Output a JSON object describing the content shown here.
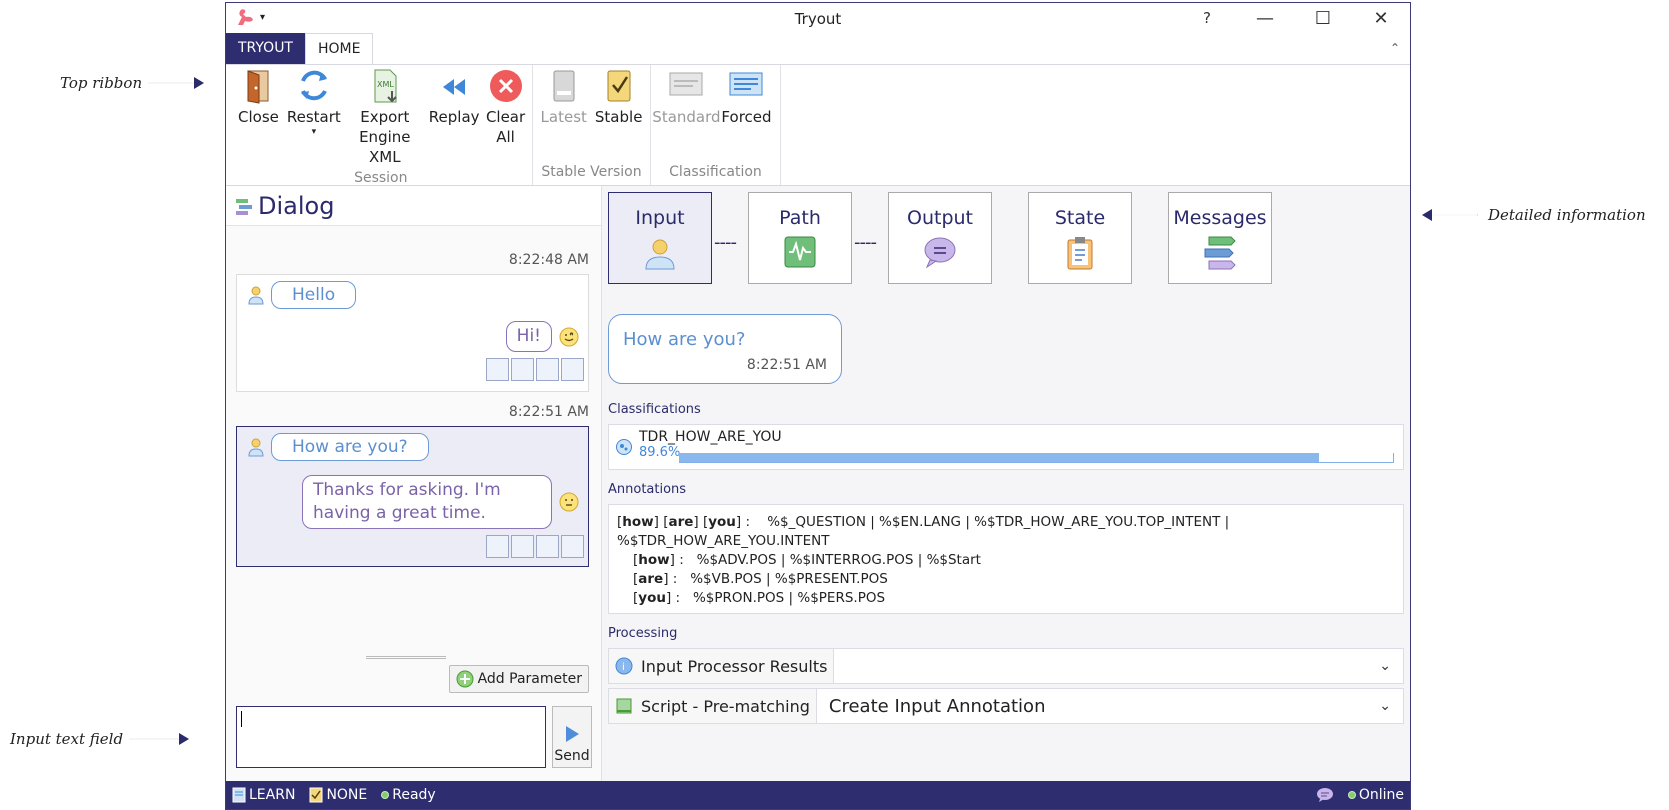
{
  "callouts": {
    "top_ribbon": "Top ribbon",
    "detailed_information": "Detailed information",
    "input_text_field": "Input text field"
  },
  "window": {
    "title": "Tryout",
    "help": "?",
    "minimize": "—",
    "maximize": "☐",
    "close": "✕"
  },
  "tabs": {
    "tryout": "TRYOUT",
    "home": "HOME"
  },
  "ribbon": {
    "session": {
      "label": "Session",
      "close": "Close",
      "restart": "Restart",
      "export": "Export Engine XML",
      "replay": "Replay",
      "clear": "Clear All"
    },
    "stable_version": {
      "label": "Stable Version",
      "latest": "Latest",
      "stable": "Stable"
    },
    "classification": {
      "label": "Classification",
      "standard": "Standard",
      "forced": "Forced"
    }
  },
  "dialog": {
    "title": "Dialog",
    "conversations": [
      {
        "time": "8:22:48 AM",
        "user": "Hello",
        "bot": "Hi!"
      },
      {
        "time": "8:22:51 AM",
        "user": "How are you?",
        "bot": "Thanks for asking. I'm having a great time."
      }
    ],
    "add_parameter": "Add Parameter",
    "send": "Send"
  },
  "details": {
    "cards": [
      "Input",
      "Path",
      "Output",
      "State",
      "Messages"
    ],
    "connector": "----",
    "selected_message": {
      "text": "How are you?",
      "time": "8:22:51 AM"
    },
    "classifications_label": "Classifications",
    "classification": {
      "name": "TDR_HOW_ARE_YOU",
      "percent": "89.6%",
      "fraction": 0.896
    },
    "annotations_label": "Annotations",
    "annotations": {
      "line1_words": [
        "how",
        "are",
        "you"
      ],
      "line1_sep": "] [",
      "line1_tags": "%$_QUESTION  |  %$EN.LANG  |  %$TDR_HOW_ARE_YOU.TOP_INTENT  |  %$TDR_HOW_ARE_YOU.INTENT",
      "sub": [
        {
          "word": "how",
          "tags": "%$ADV.POS  |  %$INTERROG.POS  |  %$Start"
        },
        {
          "word": "are",
          "tags": "%$VB.POS  |  %$PRESENT.POS"
        },
        {
          "word": "you",
          "tags": "%$PRON.POS  |  %$PERS.POS"
        }
      ]
    },
    "processing_label": "Processing",
    "processing": [
      {
        "title": "Input Processor Results",
        "value": ""
      },
      {
        "title": "Script - Pre-matching",
        "value": "Create Input Annotation"
      }
    ]
  },
  "status": {
    "learn": "LEARN",
    "none": "NONE",
    "ready": "Ready",
    "online": "Online"
  },
  "colors": {
    "accent": "#2e2d6f",
    "user_bubble": "#5b8fd0",
    "bot_bubble": "#7a63a8",
    "bar": "#8ab7ec"
  }
}
